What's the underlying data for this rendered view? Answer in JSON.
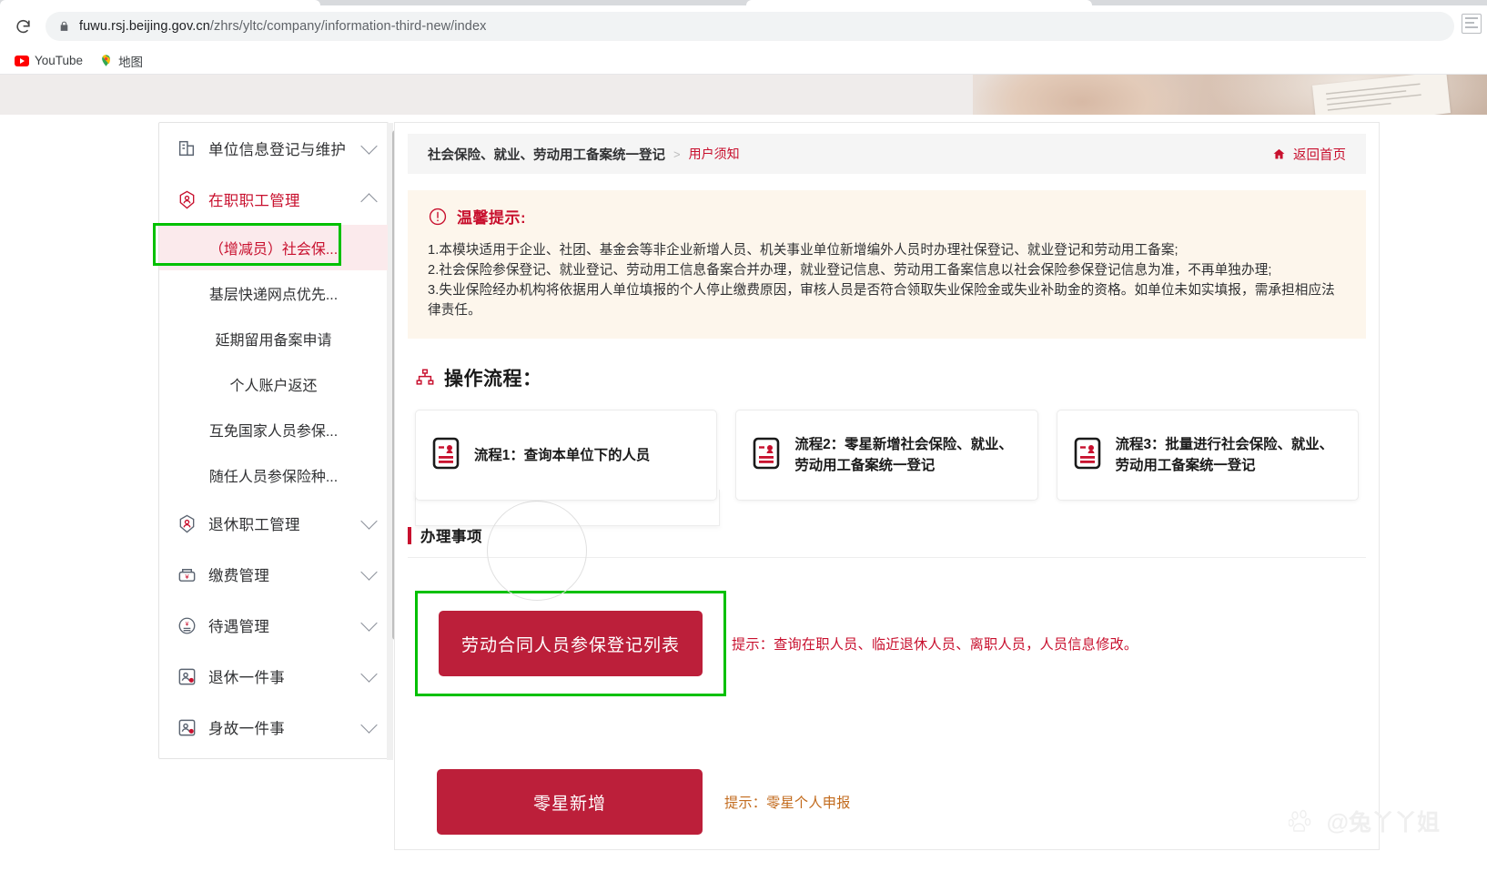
{
  "browser": {
    "reload_icon": "reload-icon",
    "lock_icon": "lock-icon",
    "url_host": "fuwu.rsj.beijing.gov.cn",
    "url_path": "/zhrs/yltc/company/information-third-new/index",
    "extension_icon": "extension-icon",
    "bookmarks": [
      {
        "label": "YouTube",
        "icon": "youtube-icon"
      },
      {
        "label": "地图",
        "icon": "google-maps-icon"
      }
    ]
  },
  "sidebar": {
    "groups": [
      {
        "label": "单位信息登记与维护",
        "icon": "building-icon",
        "expanded": false,
        "active": false
      },
      {
        "label": "在职职工管理",
        "icon": "employee-badge-icon",
        "expanded": true,
        "active": true
      },
      {
        "label": "退休职工管理",
        "icon": "retiree-badge-icon",
        "expanded": false,
        "active": false
      },
      {
        "label": "缴费管理",
        "icon": "payment-icon",
        "expanded": false,
        "active": false
      },
      {
        "label": "待遇管理",
        "icon": "benefits-icon",
        "expanded": false,
        "active": false
      },
      {
        "label": "退休一件事",
        "icon": "retirement-onething-icon",
        "expanded": false,
        "active": false
      },
      {
        "label": "身故一件事",
        "icon": "decease-onething-icon",
        "expanded": false,
        "active": false
      }
    ],
    "sub_items": [
      {
        "label": "（增减员）社会保...",
        "selected": true
      },
      {
        "label": "基层快递网点优先...",
        "selected": false
      },
      {
        "label": "延期留用备案申请",
        "selected": false
      },
      {
        "label": "个人账户返还",
        "selected": false
      },
      {
        "label": "互免国家人员参保...",
        "selected": false
      },
      {
        "label": "随任人员参保险种...",
        "selected": false
      }
    ]
  },
  "breadcrumb": {
    "main": "社会保险、就业、劳动用工备案统一登记",
    "separator": ">",
    "current": "用户须知",
    "home_label": "返回首页",
    "home_icon": "home-icon"
  },
  "tips": {
    "icon": "exclamation-circle-icon",
    "title": "温馨提示:",
    "lines": [
      "1.本模块适用于企业、社团、基金会等非企业新增人员、机关事业单位新增编外人员时办理社保登记、就业登记和劳动用工备案;",
      "2.社会保险参保登记、就业登记、劳动用工信息备案合并办理，就业登记信息、劳动用工备案信息以社会保险参保登记信息为准，不再单独办理;",
      "3.失业保险经办机构将依据用人单位填报的个人停止缴费原因，审核人员是否符合领取失业保险金或失业补助金的资格。如单位未如实填报，需承担相应法律责任。"
    ]
  },
  "flow": {
    "icon": "sitemap-icon",
    "title": "操作流程：",
    "cards": [
      {
        "icon": "id-card-icon",
        "text": "流程1：查询本单位下的人员"
      },
      {
        "icon": "id-card-icon",
        "text": "流程2：零星新增社会保险、就业、劳动用工备案统一登记"
      },
      {
        "icon": "id-card-icon",
        "text": "流程3：批量进行社会保险、就业、劳动用工备案统一登记"
      }
    ]
  },
  "handling": {
    "section_title": "办理事项",
    "actions": [
      {
        "button_label": "劳动合同人员参保登记列表",
        "hint": "提示：查询在职人员、临近退休人员、离职人员，人员信息修改。",
        "hint_color": "#c8102e",
        "highlighted": true
      },
      {
        "button_label": "零星新增",
        "hint": "提示：零星个人申报",
        "hint_color": "#c26a1c",
        "highlighted": false
      }
    ]
  },
  "watermark": {
    "logo_icon": "baidu-logo-icon",
    "text": "@兔丫丫姐"
  },
  "colors": {
    "brand_red": "#c8102e",
    "button_red": "#bc1f3a",
    "highlight_green": "#00c000",
    "tips_bg": "#fdf6ec"
  }
}
